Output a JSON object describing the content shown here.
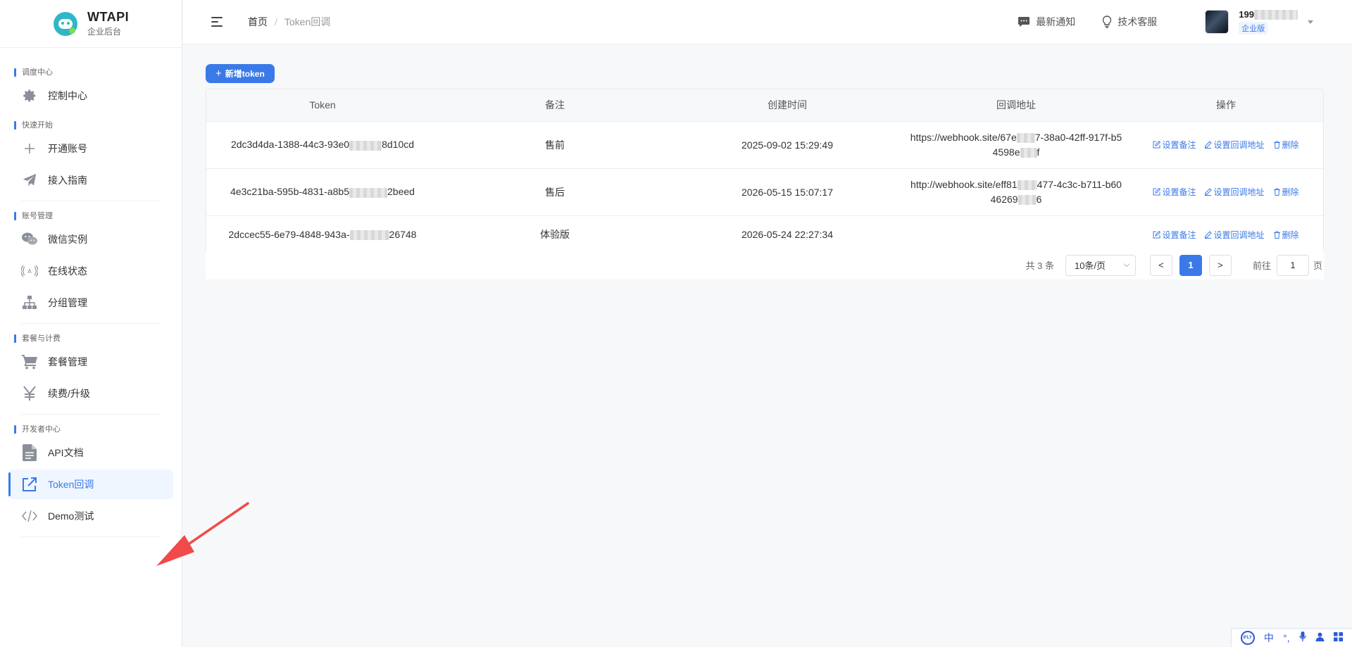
{
  "brand": {
    "name": "WTAPI",
    "subtitle": "企业后台"
  },
  "sidebar": {
    "sections": [
      {
        "title": "调度中心",
        "items": [
          {
            "label": "控制中心",
            "icon": "gear-icon"
          }
        ]
      },
      {
        "title": "快速开始",
        "items": [
          {
            "label": "开通账号",
            "icon": "plus-icon"
          },
          {
            "label": "接入指南",
            "icon": "paper-plane-icon"
          }
        ]
      },
      {
        "title": "账号管理",
        "items": [
          {
            "label": "微信实例",
            "icon": "wechat-icon"
          },
          {
            "label": "在线状态",
            "icon": "signal-icon"
          },
          {
            "label": "分组管理",
            "icon": "org-chart-icon"
          }
        ]
      },
      {
        "title": "套餐与计费",
        "items": [
          {
            "label": "套餐管理",
            "icon": "cart-icon"
          },
          {
            "label": "续费/升级",
            "icon": "yen-icon"
          }
        ]
      },
      {
        "title": "开发者中心",
        "items": [
          {
            "label": "API文档",
            "icon": "document-icon"
          },
          {
            "label": "Token回调",
            "icon": "external-link-icon",
            "active": true
          },
          {
            "label": "Demo测试",
            "icon": "code-icon"
          }
        ]
      }
    ]
  },
  "header": {
    "breadcrumb": {
      "home": "首页",
      "separator": "/",
      "current": "Token回调"
    },
    "notice_label": "最新通知",
    "support_label": "技术客服",
    "user": {
      "name_prefix": "199",
      "badge": "企业版"
    }
  },
  "toolbar": {
    "add_label": "新增token",
    "add_plus": "+"
  },
  "table": {
    "headers": {
      "token": "Token",
      "note": "备注",
      "created": "创建时间",
      "callback": "回调地址",
      "actions": "操作"
    },
    "action_labels": {
      "set_note": "设置备注",
      "set_callback": "设置回调地址",
      "delete": "删除"
    },
    "rows": [
      {
        "token_a": "2dc3d4da-1388-44c3-93e0",
        "token_b": "8d10cd",
        "note": "售前",
        "created": "2025-09-02 15:29:49",
        "url_a": "https://webhook.site/67e",
        "url_b": "7-38a0-42ff-917f-b5",
        "url_c": "4598e",
        "url_d": "f"
      },
      {
        "token_a": "4e3c21ba-595b-4831-a8b5",
        "token_b": "2beed",
        "note": "售后",
        "created": "2026-05-15 15:07:17",
        "url_a": "http://webhook.site/eff81",
        "url_b": "477-4c3c-b711-b60",
        "url_c": "46269",
        "url_d": "6"
      },
      {
        "token_a": "2dccec55-6e79-4848-943a-",
        "token_b": "26748",
        "note": "体验版",
        "created": "2026-05-24 22:27:34"
      }
    ]
  },
  "pagination": {
    "total": "共 3 条",
    "page_size": "10条/页",
    "prev": "<",
    "current_page": "1",
    "next": ">",
    "goto_label": "前往",
    "goto_value": "1",
    "goto_unit": "页"
  },
  "ime": {
    "logo": "iFLY",
    "chars": [
      "中",
      "°,",
      "🎤",
      "👤",
      "▦"
    ]
  },
  "colors": {
    "accent": "#3a7ae8",
    "annotation_arrow": "#f04a4a"
  }
}
